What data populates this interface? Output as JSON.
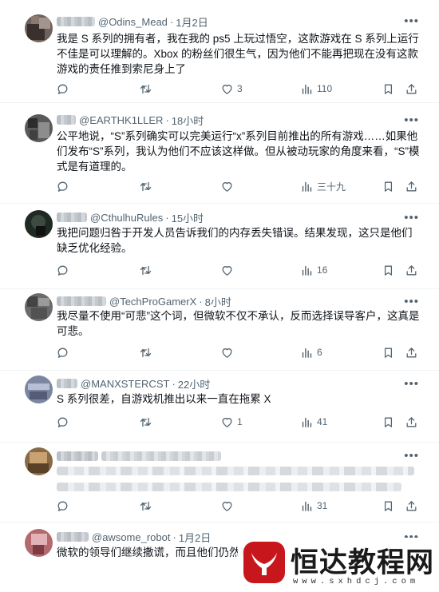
{
  "tweets": [
    {
      "handle": "@Odins_Mead",
      "time": "1月2日",
      "text": "我是 S 系列的拥有者，我在我的 ps5 上玩过悟空，这款游戏在 S 系列上运行不佳是可以理解的。Xbox 的粉丝们很生气，因为他们不能再把现在没有这款游戏的责任推到索尼身上了",
      "likes": "3",
      "views": "110"
    },
    {
      "handle": "@EARTHK1LLER",
      "time": "18小时",
      "text": "公平地说，“S”系列确实可以完美运行“x”系列目前推出的所有游戏……如果他们发布“S”系列，我认为他们不应该这样做。但从被动玩家的角度来看，“S”模式是有道理的。",
      "likes": "",
      "views": "三十九"
    },
    {
      "handle": "@CthulhuRules",
      "time": "15小时",
      "text": "我把问题归咎于开发人员告诉我们的内存丢失错误。结果发现，这只是他们缺乏优化经验。",
      "likes": "",
      "views": "16"
    },
    {
      "handle": "@TechProGamerX",
      "time": "8小时",
      "text": "我尽量不使用“可悲”这个词，但微软不仅不承认，反而选择误导客户，这真是可悲。",
      "likes": "",
      "views": "6"
    },
    {
      "handle": "@MANXSTERCST",
      "time": "22小时",
      "text": "S 系列很差，自游戏机推出以来一直在拖累 X",
      "likes": "1",
      "views": "41"
    },
    {
      "handle": "",
      "time": "",
      "text": "",
      "likes": "",
      "views": "31"
    },
    {
      "handle": "@awsome_robot",
      "time": "1月2日",
      "text": "微软的领导们继续撒谎，而且他们仍然相",
      "likes": "",
      "views": ""
    }
  ],
  "icons": {
    "reply": "reply-icon",
    "retweet": "retweet-icon",
    "like": "heart-icon",
    "views": "views-icon",
    "bookmark": "bookmark-icon",
    "share": "share-icon",
    "more": "more-icon"
  },
  "more_glyph": "•••",
  "dot": "·",
  "watermark": {
    "title": "恒达教程网",
    "url": "www.sxhdcj.com"
  },
  "colors": {
    "text": "#0f1419",
    "secondary": "#536471",
    "divider": "#eff3f4",
    "watermark_red": "#c8161d"
  }
}
